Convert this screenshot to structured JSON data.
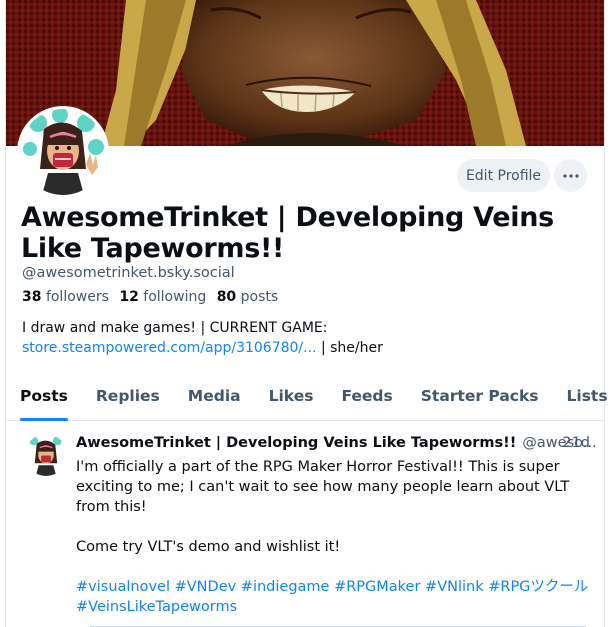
{
  "profile": {
    "display_name": "AwesomeTrinket | Developing Veins Like Tapeworms!!",
    "handle": "@awesometrinket.bsky.social",
    "followers_count": "38",
    "followers_label": "followers",
    "following_count": "12",
    "following_label": "following",
    "posts_count": "80",
    "posts_label": "posts",
    "bio_line1": "I draw and make games! | CURRENT GAME:",
    "bio_link": "store.steampowered.com/app/3106780/...",
    "bio_suffix": " | she/her"
  },
  "actions": {
    "edit_profile": "Edit Profile",
    "more_icon": "ellipsis-icon"
  },
  "tabs": [
    {
      "label": "Posts",
      "active": true
    },
    {
      "label": "Replies"
    },
    {
      "label": "Media"
    },
    {
      "label": "Likes"
    },
    {
      "label": "Feeds"
    },
    {
      "label": "Starter Packs"
    },
    {
      "label": "Lists"
    }
  ],
  "post": {
    "author_name": "AwesomeTrinket | Developing Veins Like Tapeworms!!",
    "author_handle": "@aweso...",
    "time": "· 21d",
    "paragraph1": "I'm officially a part of the RPG Maker Horror Festival!! This is super exciting to me; I can't wait to see how many people learn about VLT from this!",
    "paragraph2": "Come try VLT's demo and wishlist it!",
    "hashtags_line1": "#visualnovel #VNDev #indiegame #RPGMaker #VNlink #RPGツクール",
    "hashtags_line2": "#VeinsLikeTapeworms"
  },
  "colors": {
    "accent": "#1083fe",
    "muted_text": "#42576c",
    "button_bg": "#eef1f4"
  }
}
